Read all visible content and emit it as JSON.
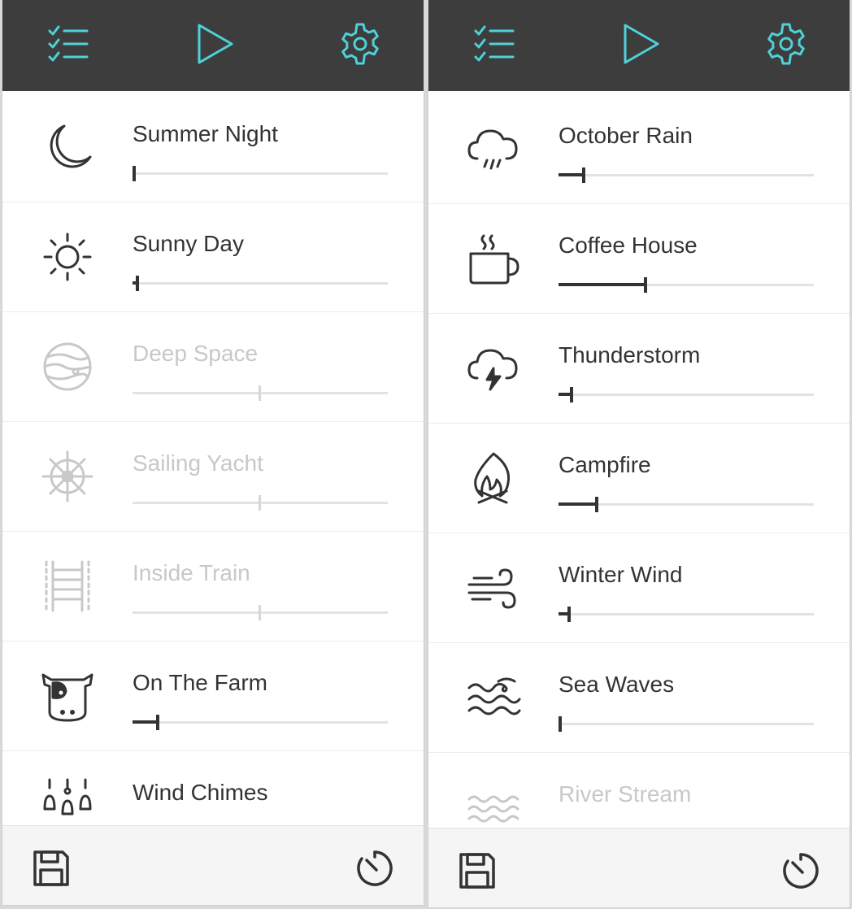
{
  "colors": {
    "accent": "#4fd1d9",
    "topbar": "#3d3d3d",
    "text": "#333333",
    "disabled": "#c8c8c8"
  },
  "panels": [
    {
      "toolbar": {
        "list_icon": "checklist-icon",
        "play_icon": "play-icon",
        "settings_icon": "gear-icon"
      },
      "sounds": [
        {
          "label": "Summer Night",
          "icon": "moon-icon",
          "enabled": true,
          "volume": 0
        },
        {
          "label": "Sunny Day",
          "icon": "sun-icon",
          "enabled": true,
          "volume": 0.02
        },
        {
          "label": "Deep Space",
          "icon": "planet-icon",
          "enabled": false,
          "volume": 0.5
        },
        {
          "label": "Sailing Yacht",
          "icon": "ship-wheel-icon",
          "enabled": false,
          "volume": 0.5
        },
        {
          "label": "Inside Train",
          "icon": "rail-track-icon",
          "enabled": false,
          "volume": 0.5
        },
        {
          "label": "On The Farm",
          "icon": "cow-icon",
          "enabled": true,
          "volume": 0.1
        },
        {
          "label": "Wind Chimes",
          "icon": "wind-chimes-icon",
          "enabled": true,
          "volume": null
        }
      ],
      "footer": {
        "save_icon": "save-icon",
        "timer_icon": "timer-icon"
      }
    },
    {
      "toolbar": {
        "list_icon": "checklist-icon",
        "play_icon": "play-icon",
        "settings_icon": "gear-icon"
      },
      "sounds": [
        {
          "label": "October Rain",
          "icon": "rain-cloud-icon",
          "enabled": true,
          "volume": 0.1
        },
        {
          "label": "Coffee House",
          "icon": "coffee-cup-icon",
          "enabled": true,
          "volume": 0.34
        },
        {
          "label": "Thunderstorm",
          "icon": "thunder-cloud-icon",
          "enabled": true,
          "volume": 0.05
        },
        {
          "label": "Campfire",
          "icon": "campfire-icon",
          "enabled": true,
          "volume": 0.15
        },
        {
          "label": "Winter Wind",
          "icon": "wind-icon",
          "enabled": true,
          "volume": 0.04
        },
        {
          "label": "Sea Waves",
          "icon": "waves-icon",
          "enabled": true,
          "volume": 0
        },
        {
          "label": "River Stream",
          "icon": "stream-icon",
          "enabled": false,
          "volume": null
        }
      ],
      "footer": {
        "save_icon": "save-icon",
        "timer_icon": "timer-icon"
      }
    }
  ]
}
